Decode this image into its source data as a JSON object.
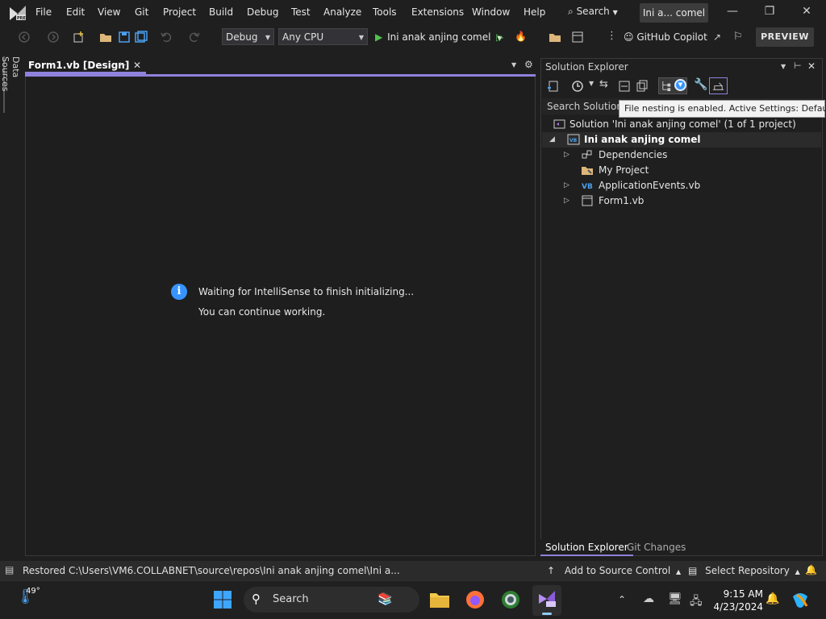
{
  "menubar": {
    "items": [
      "File",
      "Edit",
      "View",
      "Git",
      "Project",
      "Build",
      "Debug",
      "Test",
      "Analyze",
      "Tools",
      "Extensions",
      "Window",
      "Help"
    ],
    "search_label": "Search",
    "title_pill": "Ini a... comel"
  },
  "toolbar": {
    "configuration": "Debug",
    "platform": "Any CPU",
    "run_target": "Ini anak anjing comel",
    "copilot_label": "GitHub Copilot",
    "preview_label": "PREVIEW"
  },
  "left_strip": {
    "data_sources_label": "Data Sources"
  },
  "document": {
    "tab_label": "Form1.vb [Design]",
    "message_line1": "Waiting for IntelliSense to finish initializing...",
    "message_line2": "You can continue working."
  },
  "solution_explorer": {
    "title": "Solution Explorer",
    "search_placeholder": "Search Solution E",
    "tooltip": "File nesting is enabled. Active Settings: Default",
    "tree": [
      {
        "label": "Solution 'Ini anak anjing comel' (1 of 1 project)",
        "icon": "solution-icon"
      },
      {
        "label": "Ini anak anjing comel",
        "icon": "vb-project-icon"
      },
      {
        "label": "Dependencies",
        "icon": "dependencies-icon"
      },
      {
        "label": "My Project",
        "icon": "wrench-folder-icon"
      },
      {
        "label": "ApplicationEvents.vb",
        "icon": "vb-file-icon"
      },
      {
        "label": "Form1.vb",
        "icon": "form-icon"
      }
    ],
    "tabs": [
      "Solution Explorer",
      "Git Changes"
    ]
  },
  "statusbar": {
    "message": "Restored C:\\Users\\VM6.COLLABNET\\source\\repos\\Ini anak anjing comel\\Ini a...",
    "add_to_source_control": "Add to Source Control",
    "select_repository": "Select Repository"
  },
  "taskbar": {
    "weather_temp": "49°",
    "search_label": "Search",
    "time": "9:15 AM",
    "date": "4/23/2024"
  },
  "colors": {
    "accent": "#8f82dc",
    "info_blue": "#3794ff",
    "run_green": "#4ec24e",
    "background": "#1f1f1f"
  }
}
